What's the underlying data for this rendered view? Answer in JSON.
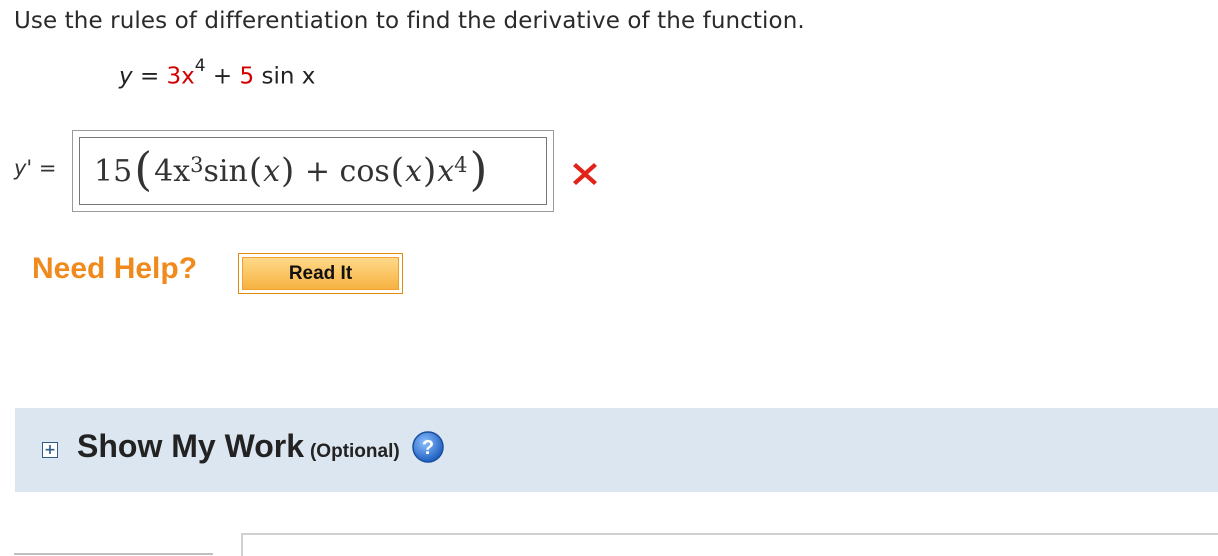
{
  "question": {
    "instruction": "Use the rules of differentiation to find the derivative of the function.",
    "function": {
      "lhs": "y",
      "equals": "=",
      "term1_coef": "3x",
      "term1_exp": "4",
      "plus": "+",
      "term2_coef": "5",
      "term2_rest": "sin x"
    }
  },
  "answer": {
    "label": "y'",
    "equals": "=",
    "coef": "15",
    "inner_a": "4x",
    "inner_a_exp": "3",
    "inner_sin": "sin",
    "inner_x1": "x",
    "plus": "+",
    "inner_cos": "cos",
    "inner_x2": "x",
    "inner_x3": "x",
    "inner_x3_exp": "4",
    "status": "incorrect"
  },
  "help": {
    "need_help": "Need Help?",
    "read_it": "Read It"
  },
  "show_my_work": {
    "expand_symbol": "+",
    "title": "Show My Work",
    "optional": "(Optional)",
    "help_symbol": "?"
  },
  "colors": {
    "red": "#d40000",
    "orange": "#f08a1c",
    "panel": "#dce6f0",
    "help_blue": "#2b6fc9"
  }
}
